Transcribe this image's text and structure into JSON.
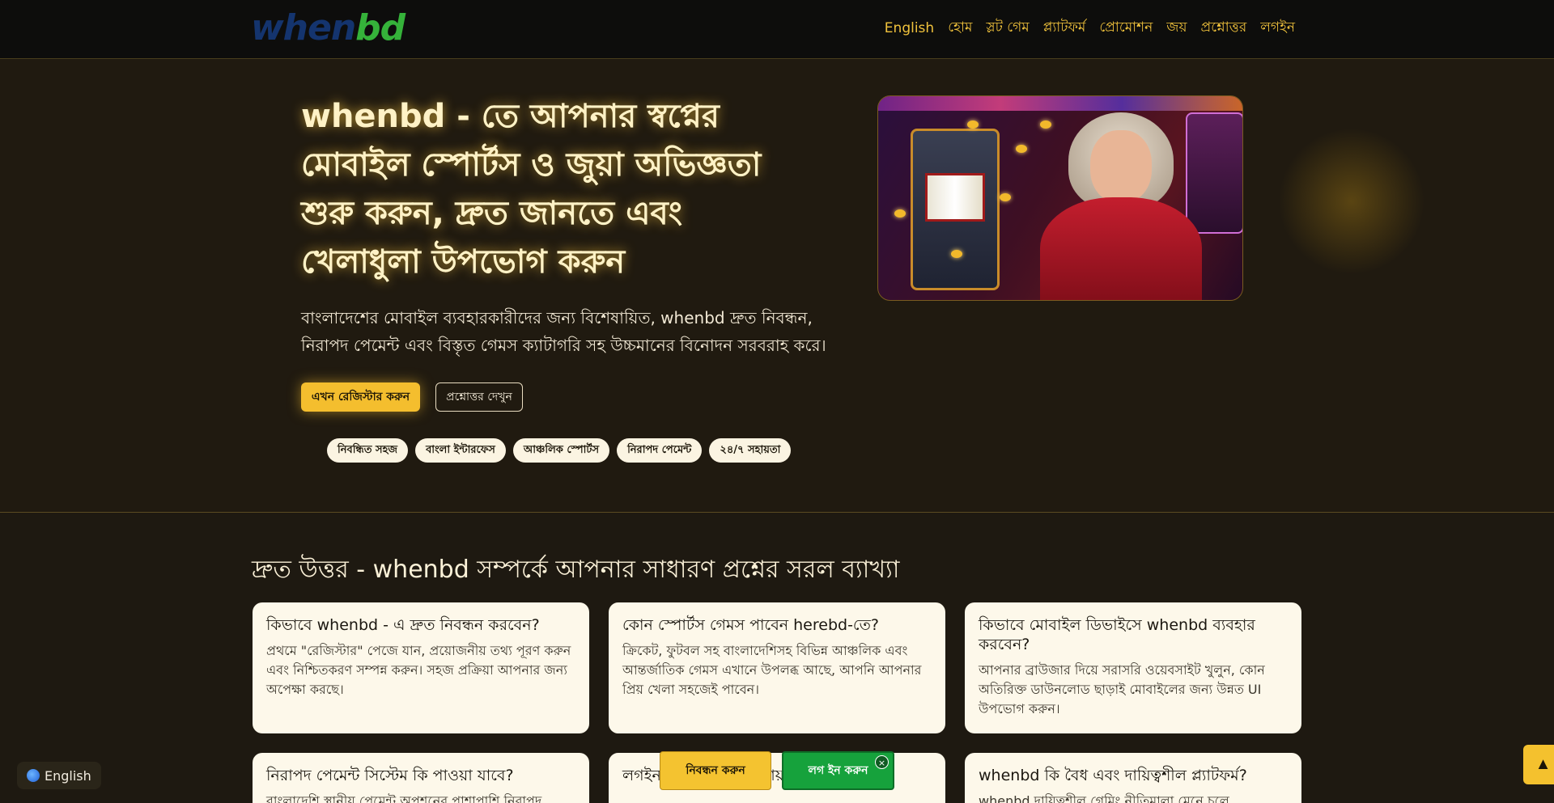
{
  "header": {
    "logo": {
      "part1": "when",
      "part2": "bd"
    },
    "nav": [
      "English",
      "হোম",
      "স্লট গেম",
      "প্ল্যাটফর্ম",
      "প্রোমোশন",
      "জয়",
      "প্রশ্নোত্তর",
      "লগইন"
    ]
  },
  "hero": {
    "title": "whenbd - তে আপনার স্বপ্নের মোবাইল স্পোর্টস ও জুয়া অভিজ্ঞতা শুরু করুন, দ্রুত জানতে এবং খেলাধুলা উপভোগ করুন",
    "description": "বাংলাদেশের মোবাইল ব্যবহারকারীদের জন্য বিশেষায়িত, whenbd দ্রুত নিবন্ধন, নিরাপদ পেমেন্ট এবং বিস্তৃত গেমস ক্যাটাগরি সহ উচ্চমানের বিনোদন সরবরাহ করে।",
    "register_button": "এখন রেজিস্টার করুন",
    "faq_button": "প্রশ্নোত্তর দেখুন",
    "chips": [
      "নিবন্ধিত সহজ",
      "বাংলা ইন্টারফেস",
      "আঞ্চলিক স্পোর্টস",
      "নিরাপদ পেমেন্ট",
      "২৪/৭ সহায়তা"
    ]
  },
  "faq": {
    "title": "দ্রুত উত্তর - whenbd সম্পর্কে আপনার সাধারণ প্রশ্নের সরল ব্যাখ্যা",
    "cards": [
      {
        "q": "কিভাবে whenbd - এ দ্রুত নিবন্ধন করবেন?",
        "a": "প্রথমে \"রেজিস্টার\" পেজে যান, প্রয়োজনীয় তথ্য পূরণ করুন এবং নিশ্চিতকরণ সম্পন্ন করুন। সহজ প্রক্রিয়া আপনার জন্য অপেক্ষা করছে।"
      },
      {
        "q": "কোন স্পোর্টস গেমস পাবেন herebd-তে?",
        "a": "ক্রিকেট, ফুটবল সহ বাংলাদেশিসহ বিভিন্ন আঞ্চলিক এবং আন্তর্জাতিক গেমস এখানে উপলব্ধ আছে, আপনি আপনার প্রিয় খেলা সহজেই পাবেন।"
      },
      {
        "q": "কিভাবে মোবাইল ডিভাইসে whenbd ব্যবহার করবেন?",
        "a": "আপনার ব্রাউজার দিয়ে সরাসরি ওয়েবসাইট খুলুন, কোন অতিরিক্ত ডাউনলোড ছাড়াই মোবাইলের জন্য উন্নত UI উপভোগ করুন।"
      },
      {
        "q": "নিরাপদ পেমেন্ট সিস্টেম কি পাওয়া যাবে?",
        "a": "বাংলাদেশি স্থানীয় পেমেন্ট অপশনের পাশাপাশি নিরাপদ"
      },
      {
        "q": "লগইন সমস্যা হলে কোথায় সহায়তা পাবেন?",
        "a": ""
      },
      {
        "q": "whenbd কি বৈধ এবং দায়িত্বশীল প্ল্যাটফর্ম?",
        "a": "whenbd দায়িত্বশীল গেমিং নীতিমালা মেনে চলে"
      }
    ]
  },
  "floating": {
    "language": "English",
    "register": "নিবন্ধন করুন",
    "login": "লগ ইন করুন",
    "close": "×",
    "scroll_top": "▲"
  }
}
